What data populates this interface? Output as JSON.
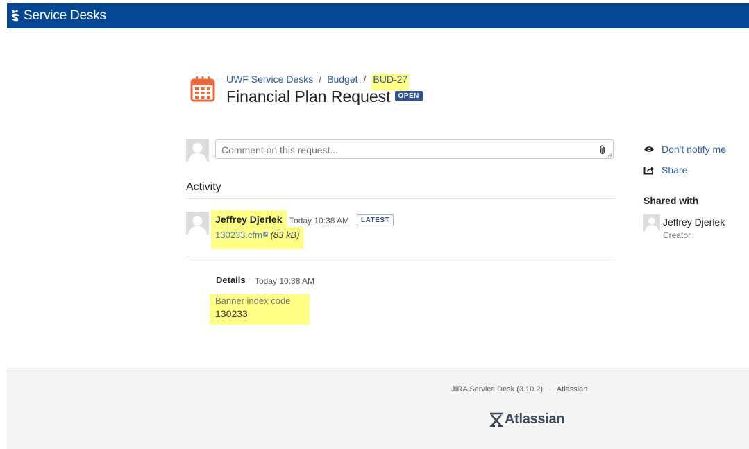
{
  "topbar": {
    "brand": "Service Desks"
  },
  "breadcrumb": {
    "desk": "UWF Service Desks",
    "project": "Budget",
    "issue_key": "BUD-27",
    "separator": "/"
  },
  "request": {
    "title": "Financial Plan Request",
    "status": "OPEN"
  },
  "comment": {
    "placeholder": "Comment on this request..."
  },
  "activity": {
    "heading": "Activity",
    "entry": {
      "author": "Jeffrey Djerlek",
      "time": "Today 10:38 AM",
      "badge": "LATEST",
      "file_name": "130233.cfm",
      "file_size": "(83 kB)"
    }
  },
  "details": {
    "label": "Details",
    "time": "Today 10:38 AM",
    "field_label": "Banner index code",
    "field_value": "130233"
  },
  "sidebar": {
    "notify_label": "Don't notify me",
    "share_label": "Share",
    "shared_heading": "Shared with",
    "shared_user": "Jeffrey Djerlek",
    "shared_role": "Creator"
  },
  "footer": {
    "product": "JIRA Service Desk (3.10.2)",
    "separator": "·",
    "company": "Atlassian",
    "logo_text": "Atlassian"
  },
  "colors": {
    "topbar": "#034694",
    "link": "#2a5b9c",
    "highlight": "#ffff86",
    "status_badge": "#34538a",
    "calendar_icon": "#e8693a"
  },
  "icons": [
    "service-desk-logo-icon",
    "calendar-icon",
    "paperclip-icon",
    "eye-icon",
    "share-icon",
    "external-link-icon",
    "atlassian-logo-icon"
  ]
}
